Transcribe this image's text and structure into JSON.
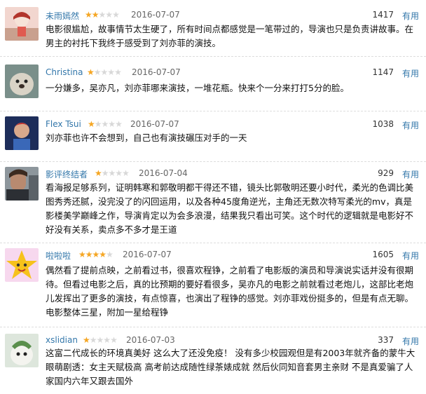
{
  "reviews": [
    {
      "user": "未雨嫣然",
      "rating": 2,
      "date": "2016-07-07",
      "votes": "1417",
      "useful": "有用",
      "text": "电影很尴尬，故事情节太生硬了，所有时间点都感觉是一笔带过的，导演也只是负责讲故事。在男主的衬托下我终于感受到了刘亦菲的演技。"
    },
    {
      "user": "Christina",
      "rating": 1,
      "date": "2016-07-07",
      "votes": "1147",
      "useful": "有用",
      "text": "一分嫌多，吴亦凡，刘亦菲哪来演技，一堆花瓶。快来个一分来打打5分的脸。"
    },
    {
      "user": "Flex Tsui",
      "rating": 1,
      "date": "2016-07-07",
      "votes": "1038",
      "useful": "有用",
      "text": "刘亦菲也许不会想到，自己也有演技碾压对手的一天"
    },
    {
      "user": "影评终结者",
      "rating": 1,
      "date": "2016-07-04",
      "votes": "929",
      "useful": "有用",
      "text": "看海报足够系列，证明韩寒和郭敬明都干得还不错，镜头比郭敬明还要小时代，柔光的色调比美图秀秀还腻，没完没了的闪回运用，以及各种45度角逆光，主角还无数次特写柔光的mv，真是影楼美学巅峰之作，导演肯定以为会多浪漫，结果我只看出可笑。这个时代的逻辑就是电影好不好没有关系，卖点多不多才是王道"
    },
    {
      "user": "啦啦啦",
      "rating": 4,
      "date": "2016-07-07",
      "votes": "1605",
      "useful": "有用",
      "text": "偶然看了提前点映，之前看过书，很喜欢程铮，之前看了电影版的演员和导演说实话并没有很期待。但看过电影之后，真的比预期的要好看很多，吴亦凡的电影之前就看过老炮儿，这部比老炮儿发挥出了更多的演技，有点惊喜，也演出了程铮的感觉。刘亦菲戏份挺多的，但是有点无聊。电影整体三星，附加一星给程铮"
    },
    {
      "user": "xslidian",
      "rating": 1,
      "date": "2016-07-03",
      "votes": "337",
      "useful": "有用",
      "text": "这富二代成长的环境真美好 这么大了还没免疫！ 没有多少校园观但是有2003年就齐备的蒙牛大眼萌剧透：女主天赋极高 高考前达成随性绿茶婊成就 然后伙同知音套男主亲财 不是真爱骗了人家国内六年又跟去国外"
    }
  ],
  "colors": {
    "username": "#3377aa",
    "useful": "#3377aa",
    "star_on": "#f5a623",
    "star_off": "#d8d8d8"
  }
}
